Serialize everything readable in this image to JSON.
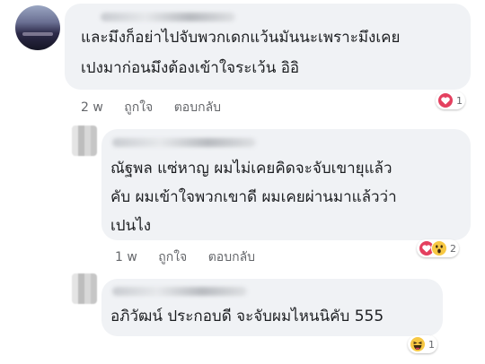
{
  "comments": [
    {
      "text_lines": [
        "และมึงก็อย่าไปจับพวกเดกแว้นมันนะเพราะมึงเคย",
        "เปงมาก่อนมึงต้องเข้าใจระเว้น อิอิ"
      ],
      "time": "2 w",
      "like": "ถูกใจ",
      "reply": "ตอบกลับ",
      "reaction_icons": [
        "love-icon"
      ],
      "reaction_count": "1"
    },
    {
      "text_lines": [
        "ณัฐพล แซ่หาญ ผมไม่เคยคิดจะจับเขายุแล้ว",
        "คับ ผมเข้าใจพวกเขาดี ผมเคยผ่านมาแล้วว่า",
        "เปนไง"
      ],
      "time": "1 w",
      "like": "ถูกใจ",
      "reply": "ตอบกลับ",
      "reaction_icons": [
        "love-icon",
        "wow-icon"
      ],
      "reaction_count": "2"
    },
    {
      "text_lines": [
        "อภิวัฒน์ ประกอบดี จะจับผมไหนนิคับ 555"
      ],
      "time": "",
      "like": "",
      "reply": "",
      "reaction_icons": [
        "haha-icon"
      ],
      "reaction_count": "1"
    }
  ],
  "colors": {
    "bubble": "#f0f2f5",
    "text": "#1c1e21",
    "meta": "#65676b",
    "love": "#e4405f",
    "haha": "#f7c843"
  }
}
